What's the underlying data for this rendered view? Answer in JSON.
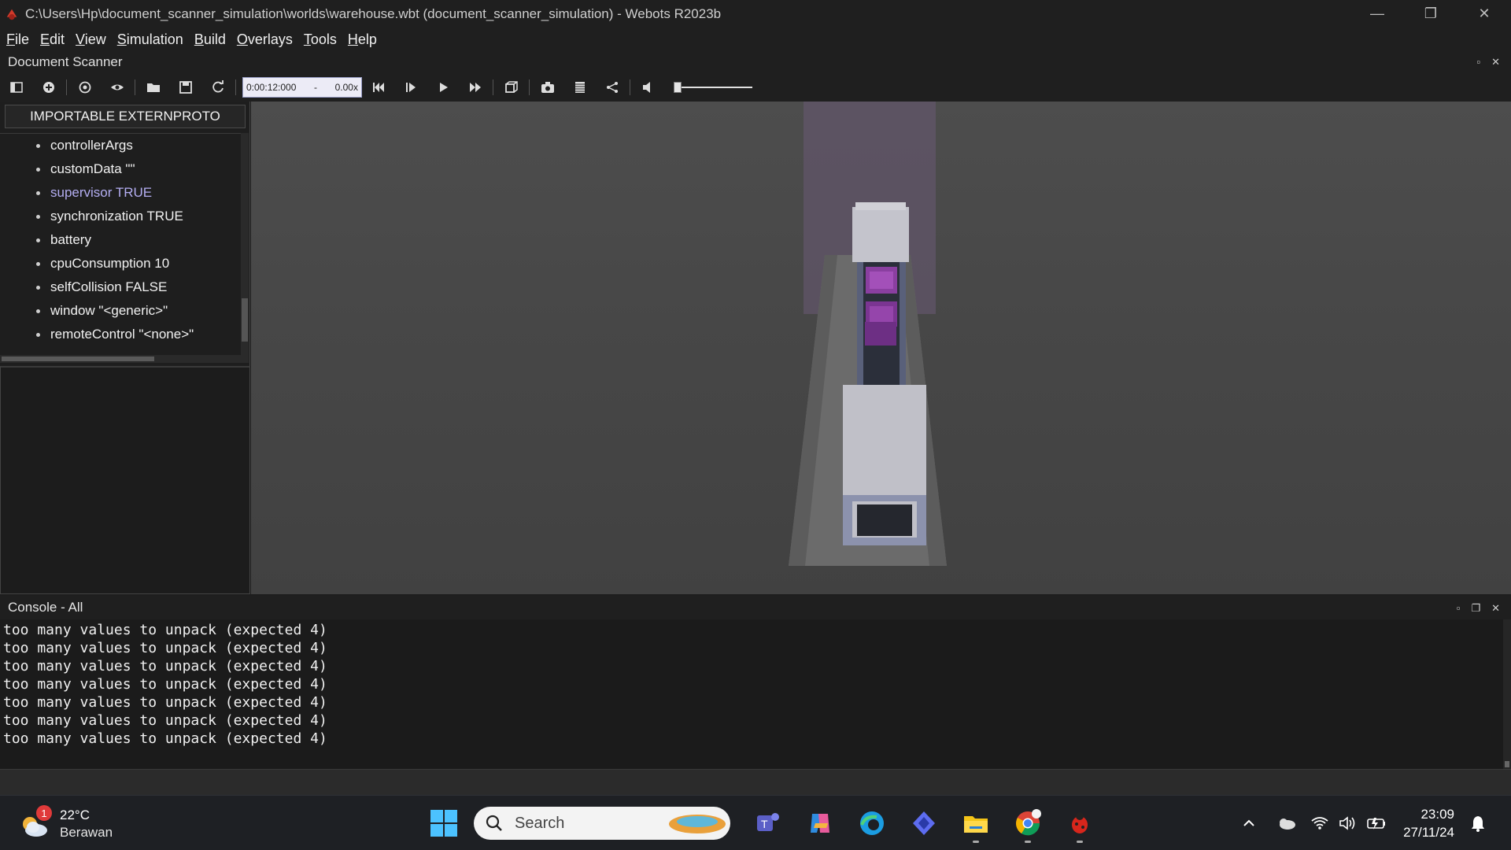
{
  "window": {
    "title": "C:\\Users\\Hp\\document_scanner_simulation\\worlds\\warehouse.wbt (document_scanner_simulation) - Webots R2023b",
    "minimize": "—",
    "restore": "❐",
    "close": "✕"
  },
  "menu": [
    {
      "label": "File",
      "u": "F",
      "rest": "ile"
    },
    {
      "label": "Edit",
      "u": "E",
      "rest": "dit"
    },
    {
      "label": "View",
      "u": "V",
      "rest": "iew"
    },
    {
      "label": "Simulation",
      "u": "S",
      "rest": "imulation"
    },
    {
      "label": "Build",
      "u": "B",
      "rest": "uild"
    },
    {
      "label": "Overlays",
      "u": "O",
      "rest": "verlays"
    },
    {
      "label": "Tools",
      "u": "T",
      "rest": "ools"
    },
    {
      "label": "Help",
      "u": "H",
      "rest": "elp"
    }
  ],
  "dock": {
    "title": "Document Scanner",
    "float": "▫",
    "close": "✕"
  },
  "toolbar": {
    "time": "0:00:12:000",
    "dash": "-",
    "speed": "0.00x"
  },
  "scene_tree": {
    "import_button": "IMPORTABLE EXTERNPROTO",
    "items": [
      {
        "label": "controllerArgs"
      },
      {
        "label": "customData \"\""
      },
      {
        "label": "supervisor TRUE",
        "highlight": true
      },
      {
        "label": "synchronization TRUE"
      },
      {
        "label": "battery"
      },
      {
        "label": "cpuConsumption 10"
      },
      {
        "label": "selfCollision FALSE"
      },
      {
        "label": "window \"<generic>\""
      },
      {
        "label": "remoteControl \"<none>\""
      }
    ]
  },
  "console": {
    "title": "Console - All",
    "float": "▫",
    "restore": "❐",
    "close": "✕",
    "lines": [
      "too many values to unpack (expected 4)",
      "too many values to unpack (expected 4)",
      "too many values to unpack (expected 4)",
      "too many values to unpack (expected 4)",
      "too many values to unpack (expected 4)",
      "too many values to unpack (expected 4)",
      "too many values to unpack (expected 4)"
    ]
  },
  "taskbar": {
    "weather_temp": "22°C",
    "weather_cond": "Berawan",
    "weather_badge": "1",
    "search_label": "Search",
    "time": "23:09",
    "date": "27/11/24"
  },
  "colors": {
    "accent": "#b4aef2",
    "time_box": "#ecebf6",
    "viewport_bg": "#474747"
  }
}
